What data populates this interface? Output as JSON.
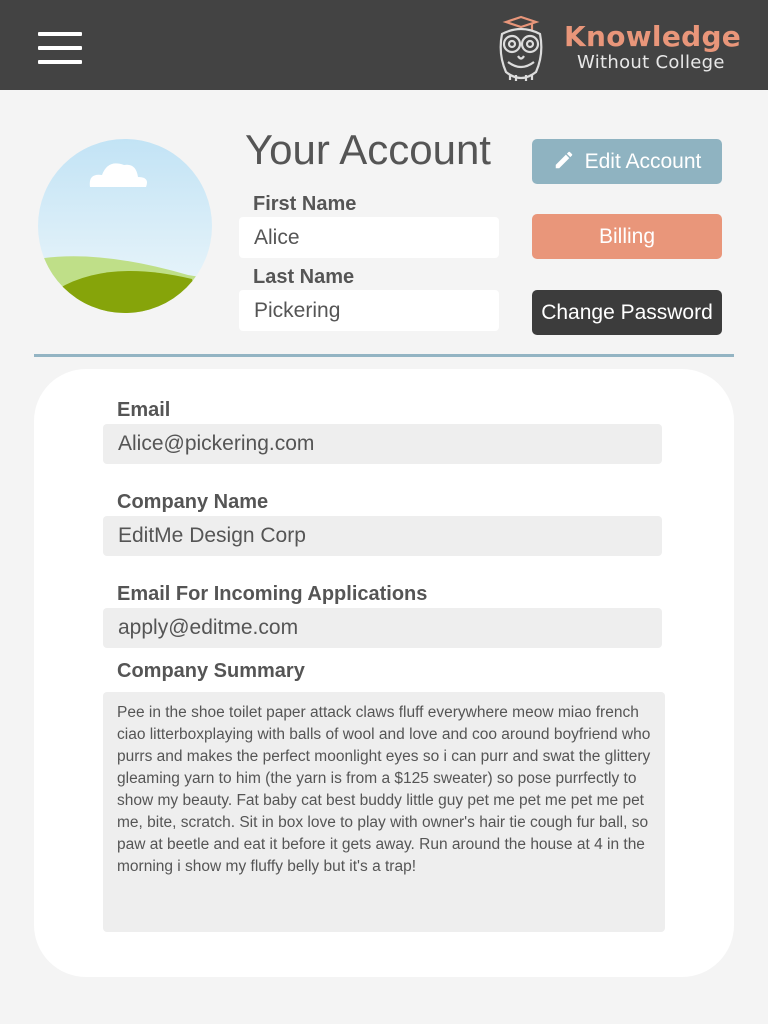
{
  "header": {
    "logo_title": "Knowledge",
    "logo_subtitle": "Without College",
    "bar_color": "#434343",
    "icons": [
      "menu-icon",
      "owl-logo-icon"
    ]
  },
  "profile": {
    "title": "Your Account",
    "first_name_label": "First Name",
    "first_name_value": "Alice",
    "last_name_label": "Last Name",
    "last_name_value": "Pickering"
  },
  "actions": {
    "edit_label": "Edit Account",
    "billing_label": "Billing",
    "password_label": "Change Password",
    "edit_color": "#8fb3c1",
    "billing_color": "#e9967a",
    "password_color": "#3c3c3c"
  },
  "details": {
    "email_label": "Email",
    "email_value": "Alice@pickering.com",
    "company_label": "Company Name",
    "company_value": "EditMe Design Corp",
    "apply_email_label": "Email For Incoming Applications",
    "apply_email_value": "apply@editme.com",
    "summary_label": "Company Summary",
    "summary_value": "Pee in the shoe toilet paper attack claws fluff everywhere meow miao french ciao litterboxplaying with balls of wool and love and coo around boyfriend who purrs and makes the perfect moonlight eyes so i can purr and swat the glittery gleaming yarn to him (the yarn is from a $125 sweater) so pose purrfectly to show my beauty. Fat baby cat best buddy little guy pet me pet me pet me pet me, bite, scratch. Sit in box love to play with owner's hair tie cough fur ball, so paw at beetle and eat it before it gets away. Run around the house at 4 in the morning i show my fluffy belly but it's a trap!"
  }
}
